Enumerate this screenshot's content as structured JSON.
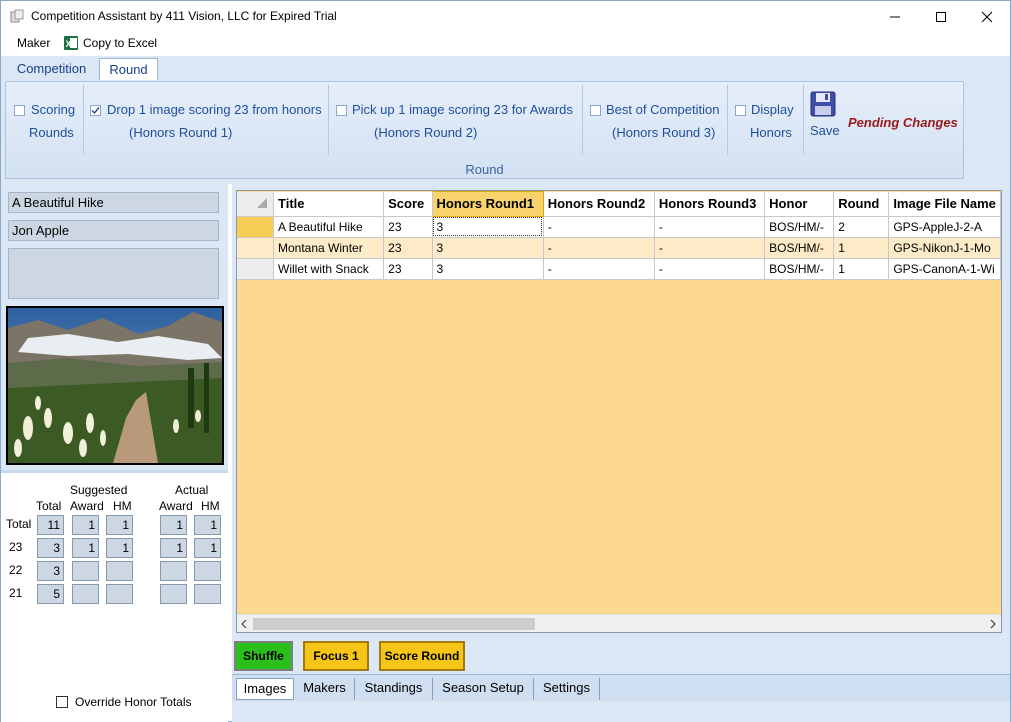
{
  "window": {
    "title": "Competition Assistant by 411 Vision, LLC for Expired Trial"
  },
  "menu": {
    "maker": "Maker",
    "copy_to_excel": "Copy to Excel"
  },
  "ribbon_tabs": [
    "Competition",
    "Round"
  ],
  "ribbon": {
    "scoring": {
      "line1": "Scoring",
      "line2": "Rounds",
      "checked": false
    },
    "drop": {
      "line1": "Drop 1 image scoring 23 from honors",
      "line2": "(Honors Round 1)",
      "checked": true
    },
    "pickup": {
      "line1": "Pick up 1 image scoring 23 for Awards",
      "line2": "(Honors Round 2)",
      "checked": false
    },
    "best": {
      "line1": "Best of Competition",
      "line2": "(Honors Round 3)",
      "checked": false
    },
    "display": {
      "line1": "Display",
      "line2": "Honors",
      "checked": false
    },
    "save_label": "Save",
    "pending": "Pending Changes",
    "group_caption": "Round"
  },
  "left": {
    "image_title": "A Beautiful Hike",
    "maker_name": "Jon Apple",
    "stats": {
      "suggested_header": "Suggested",
      "actual_header": "Actual",
      "col_total": "Total",
      "col_award": "Award",
      "col_hm": "HM",
      "rows": [
        {
          "label": "Total",
          "total": "11",
          "s_award": "1",
          "s_hm": "1",
          "a_award": "1",
          "a_hm": "1"
        },
        {
          "label": "23",
          "total": "3",
          "s_award": "1",
          "s_hm": "1",
          "a_award": "1",
          "a_hm": "1"
        },
        {
          "label": "22",
          "total": "3",
          "s_award": "",
          "s_hm": "",
          "a_award": "",
          "a_hm": ""
        },
        {
          "label": "21",
          "total": "5",
          "s_award": "",
          "s_hm": "",
          "a_award": "",
          "a_hm": ""
        }
      ]
    },
    "override_label": "Override Honor Totals"
  },
  "grid": {
    "columns": [
      "Title",
      "Score",
      "Honors Round1",
      "Honors Round2",
      "Honors Round3",
      "Honor",
      "Round",
      "Image File Name"
    ],
    "rows": [
      [
        "A Beautiful Hike",
        "23",
        "3",
        "-",
        "-",
        "BOS/HM/-",
        "2",
        "GPS-AppleJ-2-A"
      ],
      [
        "Montana Winter",
        "23",
        "3",
        "-",
        "-",
        "BOS/HM/-",
        "1",
        "GPS-NikonJ-1-Mo"
      ],
      [
        "Willet with Snack",
        "23",
        "3",
        "-",
        "-",
        "BOS/HM/-",
        "1",
        "GPS-CanonA-1-Wi"
      ]
    ]
  },
  "buttons": {
    "shuffle": "Shuffle",
    "focus": "Focus 1",
    "score_round": "Score Round"
  },
  "bottom_tabs": [
    "Images",
    "Makers",
    "Standings",
    "Season Setup",
    "Settings"
  ],
  "colors": {
    "ribbon_text": "#1f4f9c",
    "pending": "#9a1a1a",
    "grid_bg": "#fcd98f",
    "shuffle": "#2bbf1e",
    "focus": "#f5c518"
  }
}
